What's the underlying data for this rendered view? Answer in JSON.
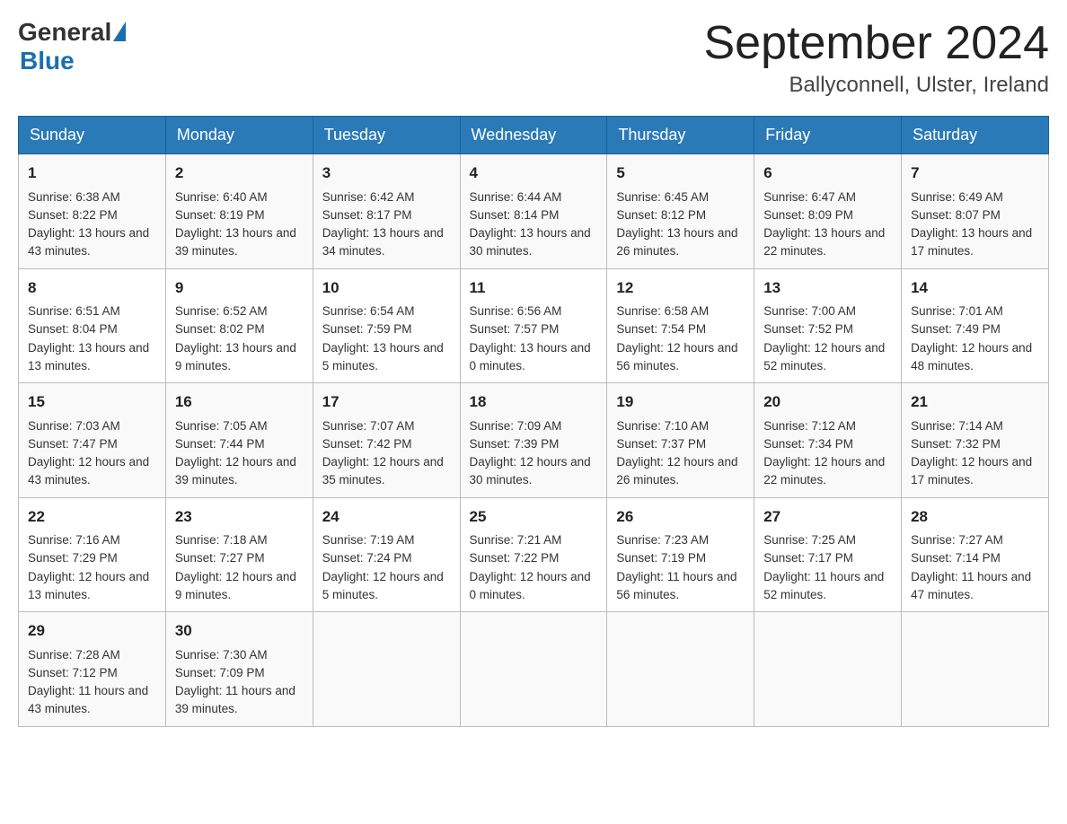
{
  "header": {
    "logo_general": "General",
    "logo_blue": "Blue",
    "title": "September 2024",
    "location": "Ballyconnell, Ulster, Ireland"
  },
  "days_of_week": [
    "Sunday",
    "Monday",
    "Tuesday",
    "Wednesday",
    "Thursday",
    "Friday",
    "Saturday"
  ],
  "weeks": [
    [
      {
        "day": "1",
        "sunrise": "Sunrise: 6:38 AM",
        "sunset": "Sunset: 8:22 PM",
        "daylight": "Daylight: 13 hours and 43 minutes."
      },
      {
        "day": "2",
        "sunrise": "Sunrise: 6:40 AM",
        "sunset": "Sunset: 8:19 PM",
        "daylight": "Daylight: 13 hours and 39 minutes."
      },
      {
        "day": "3",
        "sunrise": "Sunrise: 6:42 AM",
        "sunset": "Sunset: 8:17 PM",
        "daylight": "Daylight: 13 hours and 34 minutes."
      },
      {
        "day": "4",
        "sunrise": "Sunrise: 6:44 AM",
        "sunset": "Sunset: 8:14 PM",
        "daylight": "Daylight: 13 hours and 30 minutes."
      },
      {
        "day": "5",
        "sunrise": "Sunrise: 6:45 AM",
        "sunset": "Sunset: 8:12 PM",
        "daylight": "Daylight: 13 hours and 26 minutes."
      },
      {
        "day": "6",
        "sunrise": "Sunrise: 6:47 AM",
        "sunset": "Sunset: 8:09 PM",
        "daylight": "Daylight: 13 hours and 22 minutes."
      },
      {
        "day": "7",
        "sunrise": "Sunrise: 6:49 AM",
        "sunset": "Sunset: 8:07 PM",
        "daylight": "Daylight: 13 hours and 17 minutes."
      }
    ],
    [
      {
        "day": "8",
        "sunrise": "Sunrise: 6:51 AM",
        "sunset": "Sunset: 8:04 PM",
        "daylight": "Daylight: 13 hours and 13 minutes."
      },
      {
        "day": "9",
        "sunrise": "Sunrise: 6:52 AM",
        "sunset": "Sunset: 8:02 PM",
        "daylight": "Daylight: 13 hours and 9 minutes."
      },
      {
        "day": "10",
        "sunrise": "Sunrise: 6:54 AM",
        "sunset": "Sunset: 7:59 PM",
        "daylight": "Daylight: 13 hours and 5 minutes."
      },
      {
        "day": "11",
        "sunrise": "Sunrise: 6:56 AM",
        "sunset": "Sunset: 7:57 PM",
        "daylight": "Daylight: 13 hours and 0 minutes."
      },
      {
        "day": "12",
        "sunrise": "Sunrise: 6:58 AM",
        "sunset": "Sunset: 7:54 PM",
        "daylight": "Daylight: 12 hours and 56 minutes."
      },
      {
        "day": "13",
        "sunrise": "Sunrise: 7:00 AM",
        "sunset": "Sunset: 7:52 PM",
        "daylight": "Daylight: 12 hours and 52 minutes."
      },
      {
        "day": "14",
        "sunrise": "Sunrise: 7:01 AM",
        "sunset": "Sunset: 7:49 PM",
        "daylight": "Daylight: 12 hours and 48 minutes."
      }
    ],
    [
      {
        "day": "15",
        "sunrise": "Sunrise: 7:03 AM",
        "sunset": "Sunset: 7:47 PM",
        "daylight": "Daylight: 12 hours and 43 minutes."
      },
      {
        "day": "16",
        "sunrise": "Sunrise: 7:05 AM",
        "sunset": "Sunset: 7:44 PM",
        "daylight": "Daylight: 12 hours and 39 minutes."
      },
      {
        "day": "17",
        "sunrise": "Sunrise: 7:07 AM",
        "sunset": "Sunset: 7:42 PM",
        "daylight": "Daylight: 12 hours and 35 minutes."
      },
      {
        "day": "18",
        "sunrise": "Sunrise: 7:09 AM",
        "sunset": "Sunset: 7:39 PM",
        "daylight": "Daylight: 12 hours and 30 minutes."
      },
      {
        "day": "19",
        "sunrise": "Sunrise: 7:10 AM",
        "sunset": "Sunset: 7:37 PM",
        "daylight": "Daylight: 12 hours and 26 minutes."
      },
      {
        "day": "20",
        "sunrise": "Sunrise: 7:12 AM",
        "sunset": "Sunset: 7:34 PM",
        "daylight": "Daylight: 12 hours and 22 minutes."
      },
      {
        "day": "21",
        "sunrise": "Sunrise: 7:14 AM",
        "sunset": "Sunset: 7:32 PM",
        "daylight": "Daylight: 12 hours and 17 minutes."
      }
    ],
    [
      {
        "day": "22",
        "sunrise": "Sunrise: 7:16 AM",
        "sunset": "Sunset: 7:29 PM",
        "daylight": "Daylight: 12 hours and 13 minutes."
      },
      {
        "day": "23",
        "sunrise": "Sunrise: 7:18 AM",
        "sunset": "Sunset: 7:27 PM",
        "daylight": "Daylight: 12 hours and 9 minutes."
      },
      {
        "day": "24",
        "sunrise": "Sunrise: 7:19 AM",
        "sunset": "Sunset: 7:24 PM",
        "daylight": "Daylight: 12 hours and 5 minutes."
      },
      {
        "day": "25",
        "sunrise": "Sunrise: 7:21 AM",
        "sunset": "Sunset: 7:22 PM",
        "daylight": "Daylight: 12 hours and 0 minutes."
      },
      {
        "day": "26",
        "sunrise": "Sunrise: 7:23 AM",
        "sunset": "Sunset: 7:19 PM",
        "daylight": "Daylight: 11 hours and 56 minutes."
      },
      {
        "day": "27",
        "sunrise": "Sunrise: 7:25 AM",
        "sunset": "Sunset: 7:17 PM",
        "daylight": "Daylight: 11 hours and 52 minutes."
      },
      {
        "day": "28",
        "sunrise": "Sunrise: 7:27 AM",
        "sunset": "Sunset: 7:14 PM",
        "daylight": "Daylight: 11 hours and 47 minutes."
      }
    ],
    [
      {
        "day": "29",
        "sunrise": "Sunrise: 7:28 AM",
        "sunset": "Sunset: 7:12 PM",
        "daylight": "Daylight: 11 hours and 43 minutes."
      },
      {
        "day": "30",
        "sunrise": "Sunrise: 7:30 AM",
        "sunset": "Sunset: 7:09 PM",
        "daylight": "Daylight: 11 hours and 39 minutes."
      },
      null,
      null,
      null,
      null,
      null
    ]
  ]
}
